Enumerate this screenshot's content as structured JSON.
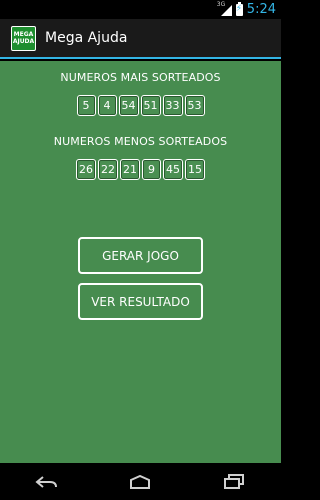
{
  "status_bar": {
    "network": "3G",
    "time": "5:24"
  },
  "action_bar": {
    "logo_text_top": "MEGA",
    "logo_text_bottom": "AJUDA",
    "title": "Mega Ajuda"
  },
  "most_drawn": {
    "title": "NUMEROS MAIS SORTEADOS",
    "numbers": [
      "5",
      "4",
      "54",
      "51",
      "33",
      "53"
    ]
  },
  "least_drawn": {
    "title": "NUMEROS MENOS SORTEADOS",
    "numbers": [
      "26",
      "22",
      "21",
      "9",
      "45",
      "15"
    ]
  },
  "buttons": {
    "generate": "GERAR JOGO",
    "results": "VER RESULTADO"
  },
  "icons": {
    "back": "back-icon",
    "home": "home-icon",
    "recents": "recents-icon"
  },
  "colors": {
    "background": "#478c4f",
    "accent": "#33b5e5"
  }
}
